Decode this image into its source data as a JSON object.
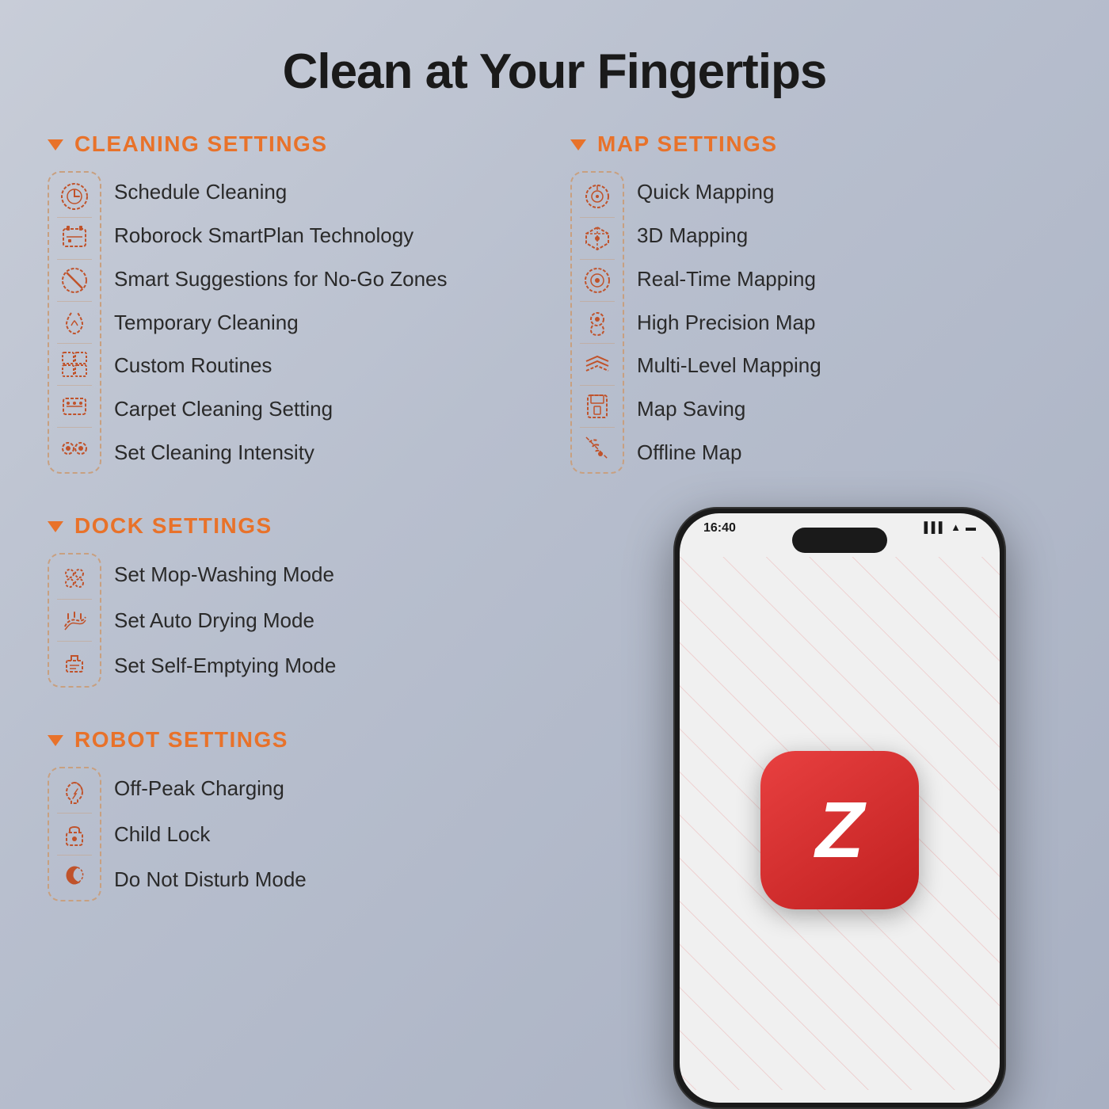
{
  "page": {
    "title": "Clean at Your Fingertips",
    "accent_color": "#e8722a",
    "bg_color": "#b8bfce"
  },
  "cleaning_settings": {
    "section_title": "CLEANING SETTINGS",
    "items": [
      {
        "icon": "⚙",
        "label": "Schedule Cleaning"
      },
      {
        "icon": "🖥",
        "label": "Roborock SmartPlan Technology"
      },
      {
        "icon": "⊘",
        "label": "Smart Suggestions for No-Go Zones"
      },
      {
        "icon": "✋",
        "label": "Temporary Cleaning"
      },
      {
        "icon": "▦",
        "label": "Custom Routines"
      },
      {
        "icon": "🪣",
        "label": "Carpet Cleaning Setting"
      },
      {
        "icon": "◉",
        "label": "Set Cleaning Intensity"
      }
    ]
  },
  "dock_settings": {
    "section_title": "DOCK SETTINGS",
    "items": [
      {
        "icon": "⚙",
        "label": "Set Mop-Washing Mode"
      },
      {
        "icon": "❋",
        "label": "Set Auto Drying Mode"
      },
      {
        "icon": "🖥",
        "label": "Set Self-Emptying Mode"
      }
    ]
  },
  "robot_settings": {
    "section_title": "ROBOT SETTINGS",
    "items": [
      {
        "icon": "🌙",
        "label": "Off-Peak Charging"
      },
      {
        "icon": "🔒",
        "label": "Child Lock"
      },
      {
        "icon": "🌛",
        "label": "Do Not Disturb Mode"
      }
    ]
  },
  "map_settings": {
    "section_title": "MAP SETTINGS",
    "items": [
      {
        "icon": "◎",
        "label": "Quick Mapping"
      },
      {
        "icon": "⬡",
        "label": "3D Mapping"
      },
      {
        "icon": "◉",
        "label": "Real-Time Mapping"
      },
      {
        "icon": "👤",
        "label": "High Precision Map"
      },
      {
        "icon": "⋈",
        "label": "Multi-Level Mapping"
      },
      {
        "icon": "💾",
        "label": "Map Saving"
      },
      {
        "icon": "📶",
        "label": "Offline Map"
      }
    ]
  },
  "phone": {
    "time": "16:40",
    "app_letter": "Z"
  }
}
